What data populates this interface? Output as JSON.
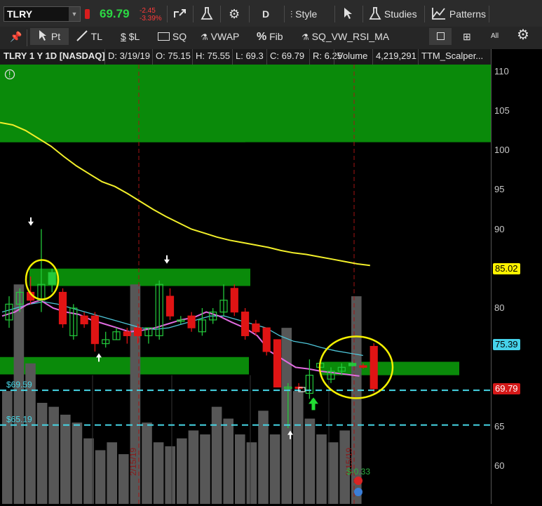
{
  "toolbar": {
    "symbol": "TLRY",
    "last_price": "69.79",
    "net_change": "-2.45",
    "pct_change": "-3.39%",
    "aggregation": "D",
    "style_label": "Style",
    "studies_label": "Studies",
    "patterns_label": "Patterns"
  },
  "drawing_tools": {
    "pointer_label": "Pt",
    "trendline_label": "TL",
    "pricelevel_label": "$L",
    "square_label": "SQ",
    "vwap_label": "VWAP",
    "fib_label": "Fib",
    "study_label": "SQ_VW_RSI_MA",
    "icon_all": "All"
  },
  "info_bar": {
    "title": "TLRY 1 Y 1D [NASDAQ]",
    "date": "D: 3/19/19",
    "open": "O: 75.15",
    "high": "H: 75.55",
    "low": "L: 69.3",
    "close": "C: 69.79",
    "range": "R: 6.25",
    "volume_label": "Volume",
    "volume_value": "4,219,291",
    "study_name": "TTM_Scalper..."
  },
  "badges": {
    "top_price": "85.02",
    "mid_price": "75.39",
    "last_price": "69.79"
  },
  "labels": {
    "level_upper": "$69.59",
    "level_lower": "$65.19",
    "date_marker_1": "2/15/19",
    "date_marker_2": "3/15/19",
    "dividend_text": "$-0.33"
  },
  "colors": {
    "up": "#23c93b",
    "down": "#e01414",
    "zone": "#0a8a0a",
    "ma_yellow": "#f2ef2a",
    "ma_pink": "#e06ce0",
    "ma_cyan": "#4ec5d8",
    "level_line": "#47d6e6",
    "volume": "#575757",
    "circle": "#f5f000"
  },
  "chart_data": {
    "type": "candlestick",
    "ylim": [
      55,
      113
    ],
    "ticks": [
      60,
      65,
      70,
      75,
      80,
      85,
      90,
      95,
      100,
      105,
      110
    ],
    "candles": [
      {
        "o": 78.5,
        "h": 81.5,
        "l": 77.5,
        "c": 80.5
      },
      {
        "o": 80.5,
        "h": 82.5,
        "l": 79.5,
        "c": 82.0
      },
      {
        "o": 82.0,
        "h": 84.0,
        "l": 80.5,
        "c": 81.0
      },
      {
        "o": 81.0,
        "h": 90.0,
        "l": 79.5,
        "c": 83.0
      },
      {
        "o": 83.0,
        "h": 85.0,
        "l": 82.0,
        "c": 84.5
      },
      {
        "o": 82.0,
        "h": 82.5,
        "l": 77.5,
        "c": 78.0
      },
      {
        "o": 76.5,
        "h": 80.5,
        "l": 76.0,
        "c": 80.0
      },
      {
        "o": 79.0,
        "h": 79.5,
        "l": 77.5,
        "c": 78.0
      },
      {
        "o": 79.0,
        "h": 79.5,
        "l": 74.5,
        "c": 75.5
      },
      {
        "o": 75.5,
        "h": 77.0,
        "l": 75.0,
        "c": 76.0
      },
      {
        "o": 76.0,
        "h": 77.5,
        "l": 76.0,
        "c": 77.0
      },
      {
        "o": 77.0,
        "h": 77.5,
        "l": 75.5,
        "c": 76.5
      },
      {
        "o": 77.5,
        "h": 78.0,
        "l": 75.5,
        "c": 76.5
      },
      {
        "o": 76.5,
        "h": 77.5,
        "l": 75.5,
        "c": 77.5
      },
      {
        "o": 76.5,
        "h": 83.5,
        "l": 76.0,
        "c": 83.0
      },
      {
        "o": 81.5,
        "h": 82.5,
        "l": 78.5,
        "c": 79.0
      },
      {
        "o": 78.5,
        "h": 79.0,
        "l": 78.0,
        "c": 78.5
      },
      {
        "o": 79.0,
        "h": 79.5,
        "l": 77.0,
        "c": 77.5
      },
      {
        "o": 77.0,
        "h": 80.0,
        "l": 76.5,
        "c": 78.5
      },
      {
        "o": 78.5,
        "h": 80.0,
        "l": 78.0,
        "c": 79.5
      },
      {
        "o": 79.5,
        "h": 83.0,
        "l": 79.0,
        "c": 81.0
      },
      {
        "o": 82.5,
        "h": 83.0,
        "l": 79.0,
        "c": 79.5
      },
      {
        "o": 79.5,
        "h": 80.0,
        "l": 76.0,
        "c": 76.5
      },
      {
        "o": 78.0,
        "h": 78.5,
        "l": 76.5,
        "c": 77.0
      },
      {
        "o": 77.5,
        "h": 77.5,
        "l": 74.0,
        "c": 74.5
      },
      {
        "o": 76.0,
        "h": 76.0,
        "l": 70.0,
        "c": 70.0
      },
      {
        "o": 70.0,
        "h": 70.5,
        "l": 64.8,
        "c": 70.0
      },
      {
        "o": 70.0,
        "h": 70.5,
        "l": 69.5,
        "c": 69.9
      },
      {
        "o": 69.2,
        "h": 73.5,
        "l": 68.5,
        "c": 71.5
      },
      {
        "o": 72.5,
        "h": 73.5,
        "l": 72.0,
        "c": 73.0
      },
      {
        "o": 71.0,
        "h": 72.5,
        "l": 70.5,
        "c": 72.0
      },
      {
        "o": 72.0,
        "h": 73.0,
        "l": 71.5,
        "c": 72.5
      },
      {
        "o": 72.7,
        "h": 73.2,
        "l": 72.6,
        "c": 73.0
      },
      {
        "o": 72.7,
        "h": 73.0,
        "l": 72.3,
        "c": 72.5
      },
      {
        "o": 75.15,
        "h": 75.55,
        "l": 69.3,
        "c": 69.79
      }
    ],
    "volume_top_prices": [
      69.5,
      83.0,
      73.0,
      68.0,
      67.5,
      66.5,
      65.5,
      63.5,
      62.0,
      63.0,
      61.5,
      83.0,
      65.5,
      63.0,
      62.5,
      63.5,
      64.5,
      64.0,
      67.5,
      66.0,
      64.0,
      63.0,
      67.0,
      64.0,
      77.5,
      69.5,
      66.0,
      64.0,
      63.0,
      64.5,
      81.5
    ],
    "ma_yellow": [
      103.5,
      103.2,
      102.5,
      101.5,
      100.5,
      99.2,
      98.0,
      97.0,
      96.0,
      95.4,
      94.5,
      93.5,
      92.5,
      91.6,
      90.8,
      90.0,
      89.5,
      89.0,
      88.6,
      88.3,
      88.0,
      87.7,
      87.3,
      87.0,
      86.8,
      86.5,
      86.2,
      85.9,
      85.6,
      85.4
    ],
    "ma_pink": [
      79.0,
      79.5,
      80.5,
      81.0,
      80.0,
      79.5,
      79.2,
      78.5,
      78.0,
      77.5,
      77.0,
      77.2,
      77.5,
      78.0,
      78.5,
      78.8,
      79.5,
      79.0,
      78.2,
      77.5,
      76.5,
      74.5,
      73.5,
      72.5,
      72.3,
      72.0,
      71.8,
      71.6,
      71.4
    ],
    "ma_cyan": [
      79.5,
      80.0,
      80.5,
      80.8,
      80.5,
      80.0,
      79.5,
      79.0,
      78.5,
      78.0,
      77.5,
      77.3,
      77.5,
      78.0,
      78.5,
      79.0,
      79.0,
      78.5,
      78.0,
      77.5,
      76.5,
      75.8,
      75.5,
      75.0,
      74.6,
      74.3,
      74.0
    ],
    "zones": [
      {
        "from": 101.0,
        "to": 112.0
      },
      {
        "from": 82.8,
        "to": 85.0
      },
      {
        "from": 71.6,
        "to": 73.8
      },
      {
        "from": 71.5,
        "to": 73.2
      }
    ],
    "levels": [
      69.59,
      65.19
    ],
    "grid": false
  }
}
